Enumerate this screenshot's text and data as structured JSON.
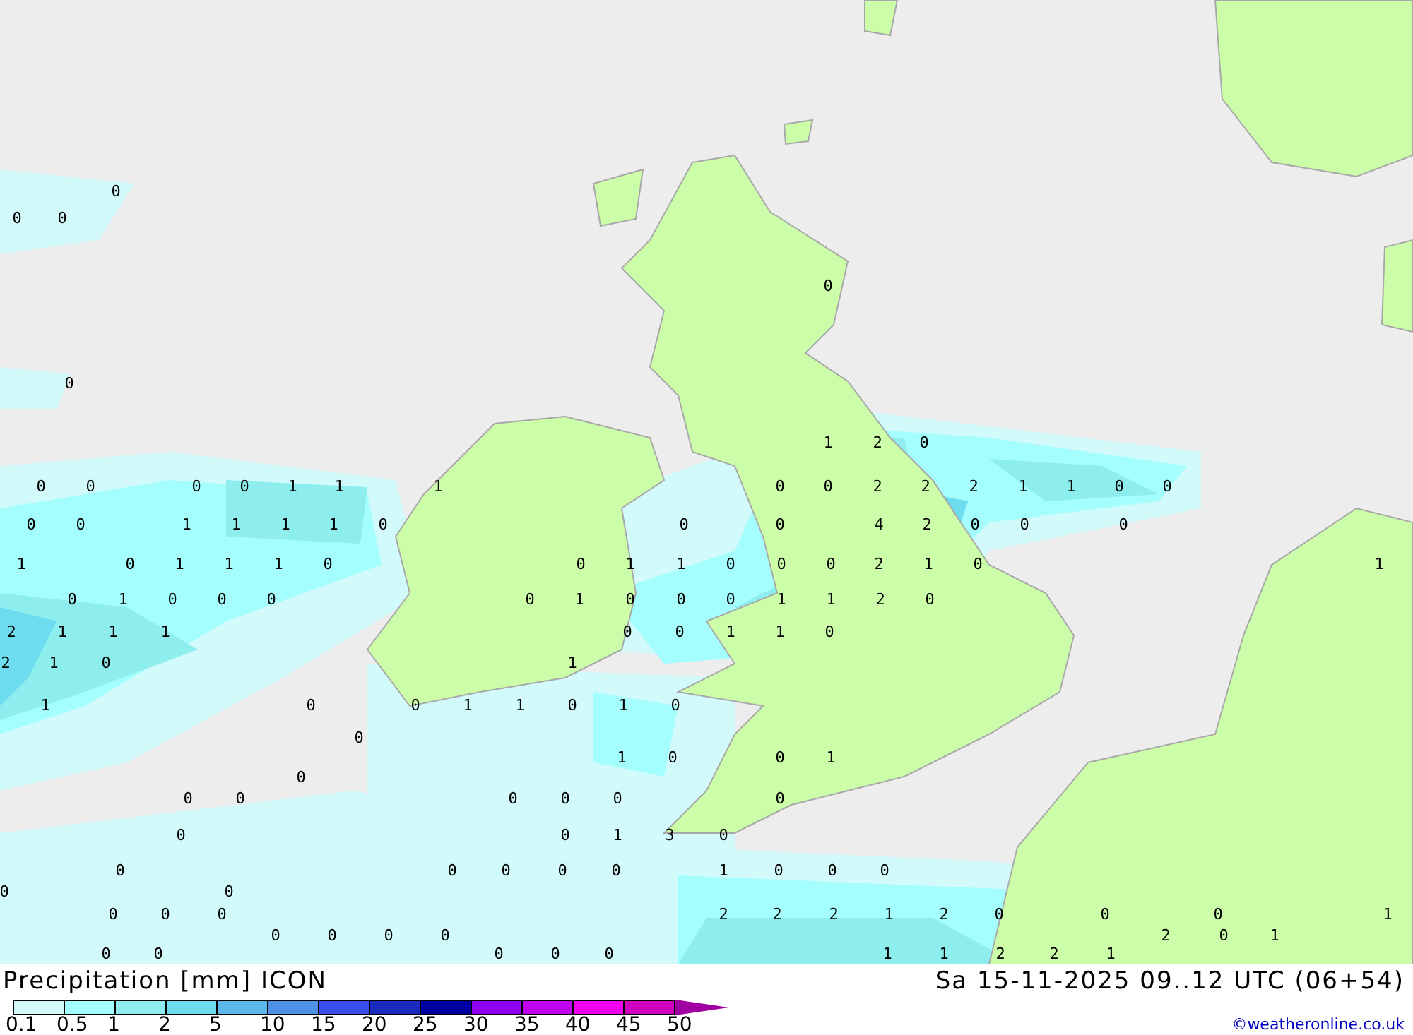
{
  "map": {
    "values": [
      "0",
      "0",
      "0",
      "0",
      "0",
      "1",
      "2",
      "0",
      "0",
      "0",
      "0",
      "0",
      "1",
      "1",
      "1",
      "0",
      "0",
      "2",
      "2",
      "2",
      "1",
      "1",
      "0",
      "0",
      "0",
      "0",
      "1",
      "1",
      "1",
      "1",
      "0",
      "0",
      "0",
      "4",
      "2",
      "0",
      "0",
      "0",
      "1",
      "0",
      "1",
      "1",
      "1",
      "0",
      "0",
      "1",
      "1",
      "0",
      "0",
      "0",
      "2",
      "1",
      "0",
      "1",
      "0",
      "1",
      "0",
      "0",
      "0",
      "0",
      "1",
      "0",
      "0",
      "0",
      "1",
      "1",
      "2",
      "0",
      "2",
      "1",
      "1",
      "1",
      "0",
      "0",
      "1",
      "1",
      "0",
      "2",
      "1",
      "0",
      "1",
      "1",
      "0",
      "0",
      "1",
      "1",
      "0",
      "1",
      "0",
      "0",
      "1",
      "0",
      "0",
      "1",
      "0",
      "0",
      "0",
      "0",
      "0",
      "0",
      "0",
      "0",
      "0",
      "1",
      "3",
      "0",
      "0",
      "0",
      "0",
      "0",
      "0",
      "1",
      "0",
      "0",
      "0",
      "0",
      "0",
      "0",
      "0",
      "0",
      "2",
      "2",
      "2",
      "1",
      "2",
      "0",
      "0",
      "0",
      "1",
      "0",
      "0",
      "0",
      "0",
      "2",
      "0",
      "1",
      "0",
      "0",
      "0",
      "0",
      "0",
      "1",
      "1",
      "2",
      "2",
      "1"
    ]
  },
  "legend": {
    "title": "Precipitation [mm] ICON",
    "date": "Sa 15-11-2025 09..12 UTC (06+54)",
    "credit": "©weatheronline.co.uk",
    "labels": [
      "0.1",
      "0.5",
      "1",
      "2",
      "5",
      "10",
      "15",
      "20",
      "25",
      "30",
      "35",
      "40",
      "45",
      "50"
    ],
    "bins": [
      {
        "kind": "bin",
        "color": "#d2fafa"
      },
      {
        "kind": "bin",
        "color": "#a5fefe"
      },
      {
        "kind": "bin",
        "color": "#8eeeee"
      },
      {
        "kind": "bin",
        "color": "#6cdcee"
      },
      {
        "kind": "bin",
        "color": "#5ab9ea"
      },
      {
        "kind": "bin",
        "color": "#4f91e6"
      },
      {
        "kind": "bin",
        "color": "#3a4ef0"
      },
      {
        "kind": "bin",
        "color": "#1a2cc0"
      },
      {
        "kind": "bin",
        "color": "#0000a0"
      },
      {
        "kind": "bin",
        "color": "#9000f0"
      },
      {
        "kind": "bin",
        "color": "#c000f0"
      },
      {
        "kind": "bin",
        "color": "#f000f0"
      },
      {
        "kind": "bin",
        "color": "#d000c0"
      },
      {
        "kind": "arrow",
        "color": "#a000a0"
      }
    ]
  }
}
